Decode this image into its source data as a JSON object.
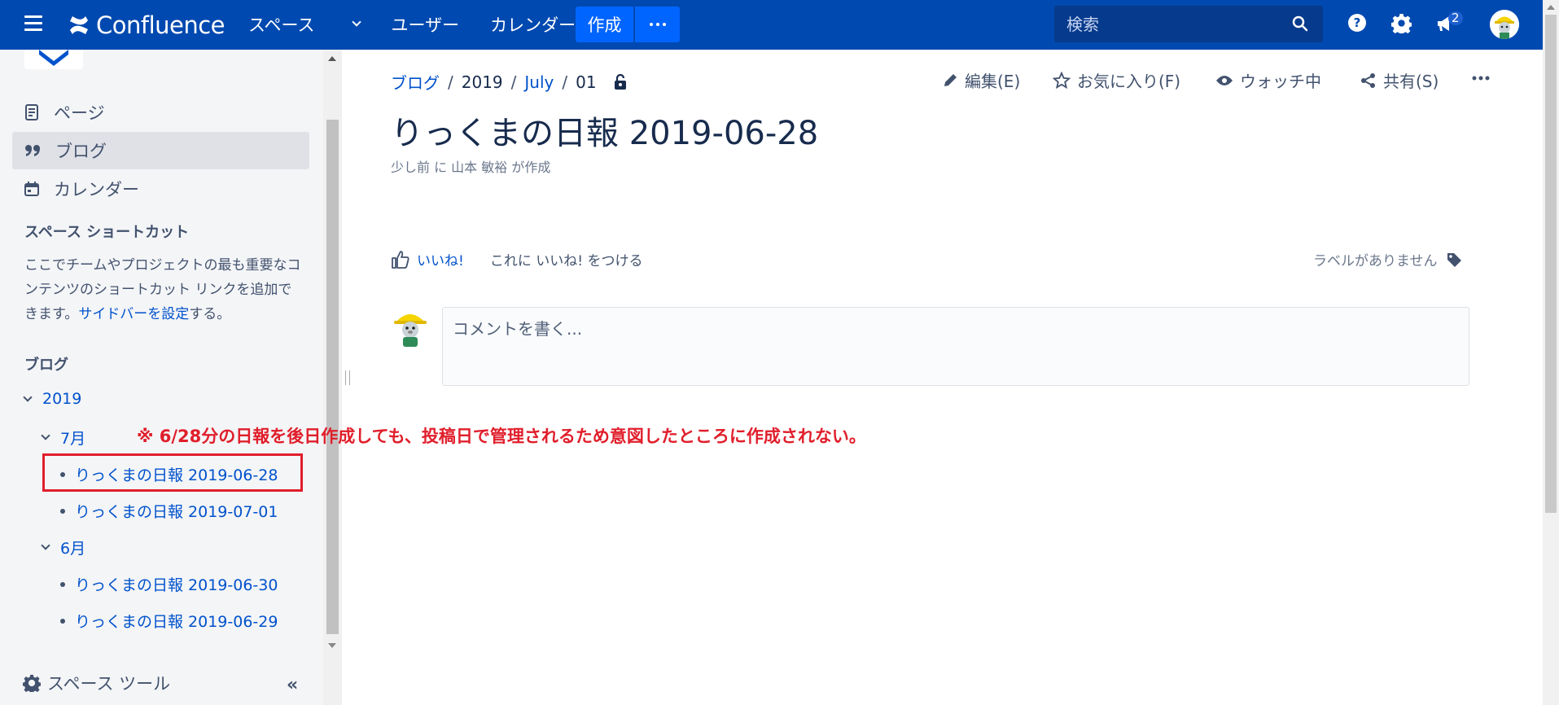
{
  "topnav": {
    "brand": "Confluence",
    "links": [
      "スペース",
      "ユーザー",
      "カレンダー"
    ],
    "create_label": "作成",
    "search_placeholder": "検索",
    "notifications_count": "2",
    "brand_color": "#0049b0"
  },
  "sidebar": {
    "nav": [
      {
        "label": "ページ",
        "icon": "page-icon"
      },
      {
        "label": "ブログ",
        "icon": "quote-icon"
      },
      {
        "label": "カレンダー",
        "icon": "calendar-icon"
      }
    ],
    "shortcuts_heading": "スペース ショートカット",
    "shortcuts_text_before": "ここでチームやプロジェクトの最も重要なコンテンツのショートカット リンクを追加できます。",
    "shortcuts_link": "サイドバーを設定",
    "shortcuts_text_after": "する。",
    "blog_heading": "ブログ",
    "tree": {
      "year": "2019",
      "july": "7月",
      "july_posts": [
        "りっくまの日報 2019-06-28",
        "りっくまの日報 2019-07-01"
      ],
      "june": "6月",
      "june_posts": [
        "りっくまの日報 2019-06-30",
        "りっくまの日報 2019-06-29"
      ]
    },
    "space_tools": "スペース ツール",
    "collapse": "«"
  },
  "main": {
    "breadcrumb": [
      "ブログ",
      "2019",
      "July",
      "01"
    ],
    "actions": {
      "edit": "編集(E)",
      "favorite": "お気に入り(F)",
      "watch": "ウォッチ中",
      "share": "共有(S)"
    },
    "title": "りっくまの日報 2019-06-28",
    "byline": "少し前 に 山本 敏裕 が作成",
    "like_link": "いいね!",
    "like_text": "これに いいね! をつける",
    "labels_text": "ラベルがありません",
    "comment_placeholder": "コメントを書く...",
    "annotation": "※ 6/28分の日報を後日作成しても、投稿日で管理されるため意図したところに作成されない。"
  }
}
